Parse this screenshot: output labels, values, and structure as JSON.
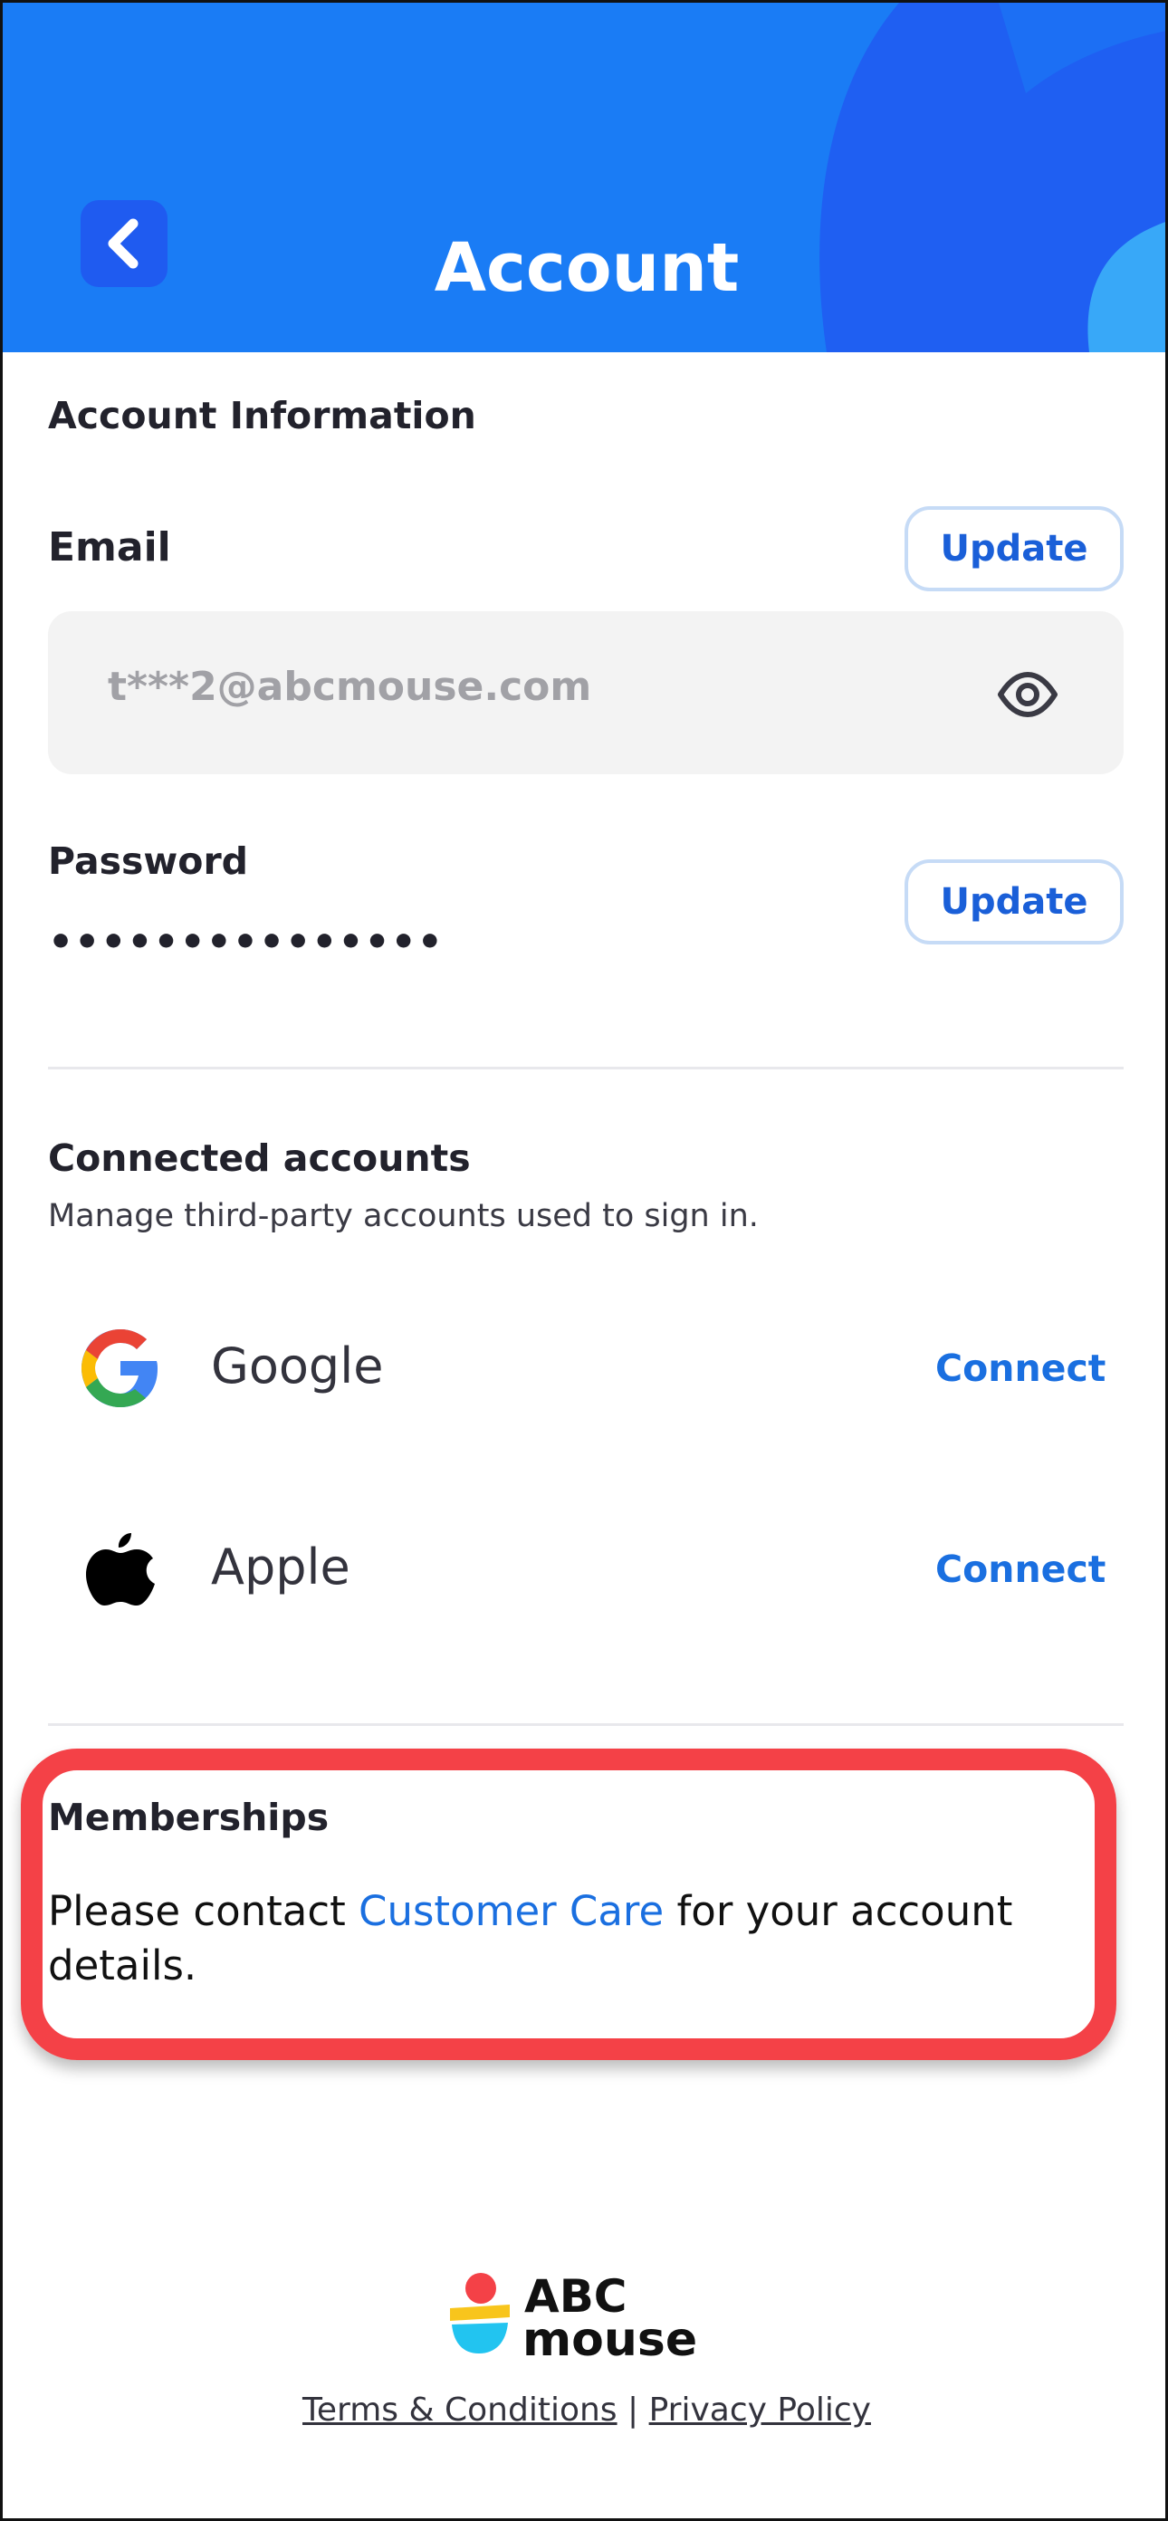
{
  "header": {
    "title": "Account",
    "back_icon": "chevron-left-icon",
    "colors": {
      "background": "#1a7cf5",
      "back_button": "#1f5bf0"
    }
  },
  "account_info": {
    "section_title": "Account Information",
    "email": {
      "label": "Email",
      "update_label": "Update",
      "value": "t***2@abcmouse.com",
      "visibility_icon": "eye-icon"
    },
    "password": {
      "label": "Password",
      "update_label": "Update",
      "masked_value": "•••••••••••••••"
    }
  },
  "connected_accounts": {
    "title": "Connected accounts",
    "subtitle": "Manage third-party accounts used to sign in.",
    "providers": [
      {
        "name": "Google",
        "icon": "google-icon",
        "action": "Connect"
      },
      {
        "name": "Apple",
        "icon": "apple-icon",
        "action": "Connect"
      }
    ]
  },
  "memberships": {
    "title": "Memberships",
    "text_before": "Please contact ",
    "link": "Customer Care",
    "text_after": " for your account details.",
    "highlight_color": "#f44147"
  },
  "footer": {
    "logo_text_1": "ABC",
    "logo_text_2": "mouse",
    "terms": "Terms & Conditions",
    "separator": "|",
    "privacy": "Privacy Policy"
  },
  "colors": {
    "accent": "#1a6fe0",
    "text": "#22222c"
  }
}
